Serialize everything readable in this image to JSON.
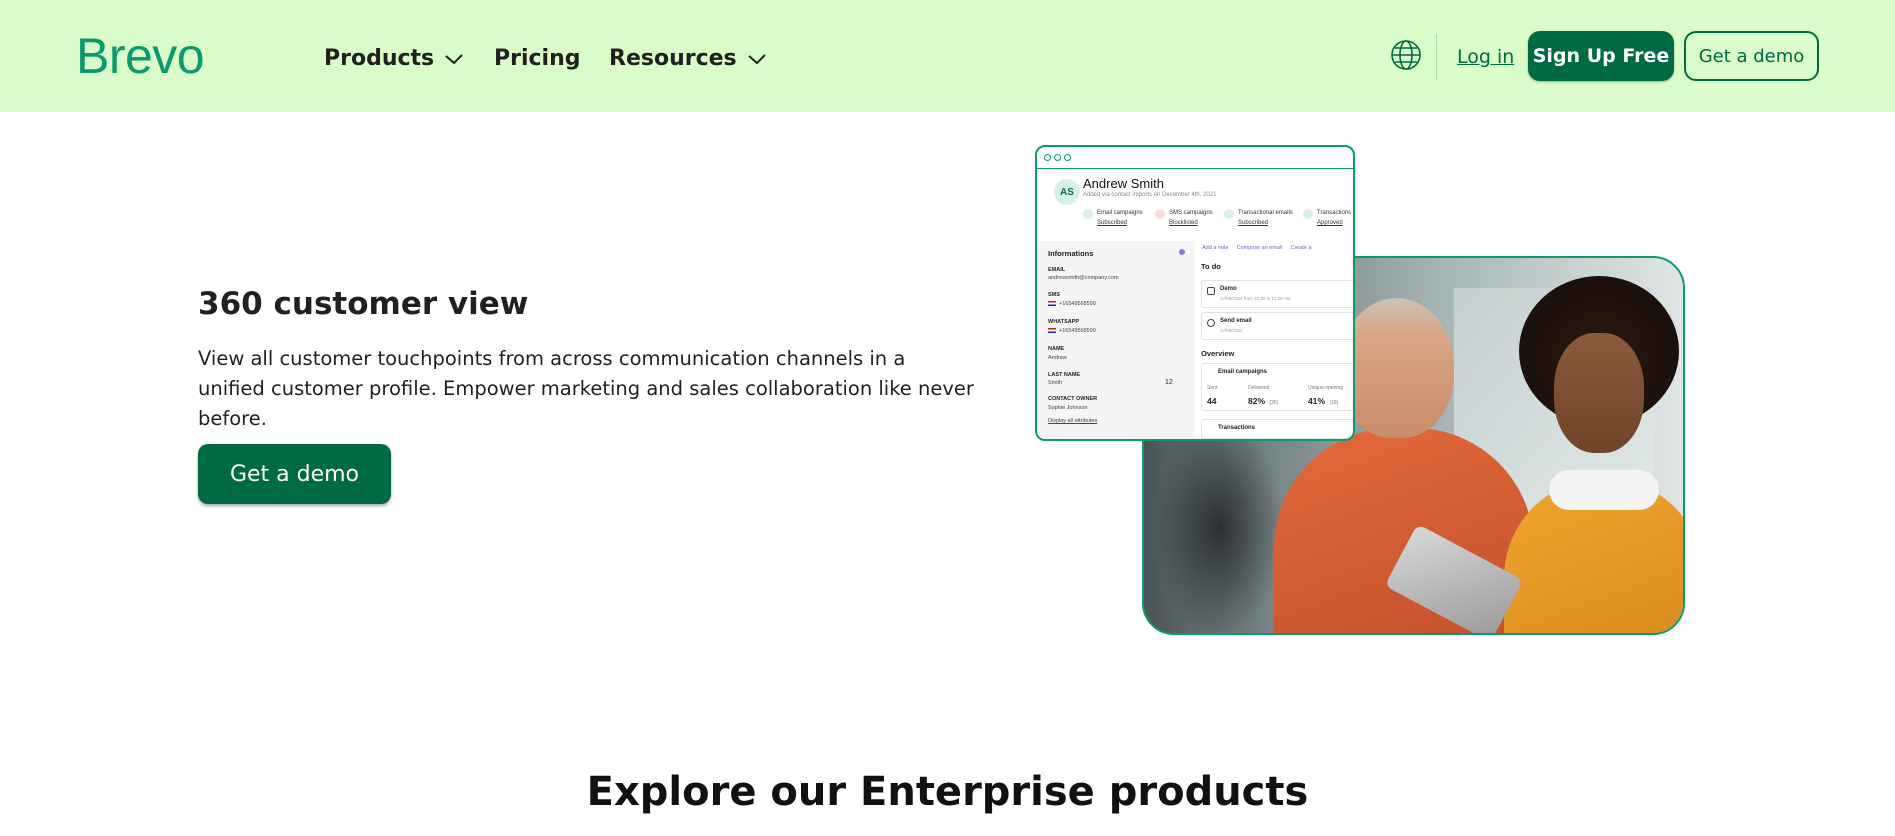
{
  "header": {
    "logo": "Brevo",
    "nav": [
      {
        "label": "Products",
        "has_dropdown": true
      },
      {
        "label": "Pricing",
        "has_dropdown": false
      },
      {
        "label": "Resources",
        "has_dropdown": true
      }
    ],
    "language_icon": "globe-icon",
    "login_label": "Log in",
    "signup_label": "Sign Up Free",
    "demo_label": "Get a demo",
    "colors": {
      "background": "#d9fcc8",
      "brand": "#006a43",
      "logo": "#0b996e"
    }
  },
  "hero": {
    "title": "360 customer view",
    "description": "View all customer touchpoints from across communication channels in a unified customer profile. Empower marketing and sales collaboration like never before.",
    "cta_label": "Get a demo"
  },
  "profile_card": {
    "initials": "AS",
    "name": "Andrew Smith",
    "subtitle": "Added via contact imports on December 4th, 2021",
    "channels": [
      {
        "label": "Email campaigns",
        "status": "Subscribed"
      },
      {
        "label": "SMS campaigns",
        "status": "Blocklisted"
      },
      {
        "label": "Transactional emails",
        "status": "Subscribed"
      },
      {
        "label": "Transactions",
        "status": "Approved"
      }
    ],
    "informations_title": "Informations",
    "fields": [
      {
        "label": "EMAIL",
        "value": "andrewsmith@company.com"
      },
      {
        "label": "SMS",
        "value": "+16549568599"
      },
      {
        "label": "WHATSAPP",
        "value": "+16549568599"
      },
      {
        "label": "NAME",
        "value": "Andrew"
      },
      {
        "label": "LAST NAME",
        "value": "Smith"
      },
      {
        "label": "CONTACT OWNER",
        "value": "Sophie Johnson"
      }
    ],
    "last_name_count": "12",
    "display_all_label": "Display all attributes",
    "actions": [
      "Add a note",
      "Compose an email",
      "Create a"
    ],
    "todo_title": "To do",
    "todos": [
      {
        "label": "Demo",
        "sub": "17/09/2022 from 10:30 to 11:00 AM"
      },
      {
        "label": "Send email",
        "sub": "17/09/2022"
      }
    ],
    "overview_title": "Overview",
    "email_campaigns_label": "Email campaigns",
    "stats": [
      {
        "key": "Sent",
        "value": "44",
        "extra": ""
      },
      {
        "key": "Delivered",
        "value": "82%",
        "extra": "(35)"
      },
      {
        "key": "Unique opening",
        "value": "41%",
        "extra": "(18)"
      }
    ],
    "transactions_label": "Transactions"
  },
  "explore_title": "Explore our Enterprise products"
}
